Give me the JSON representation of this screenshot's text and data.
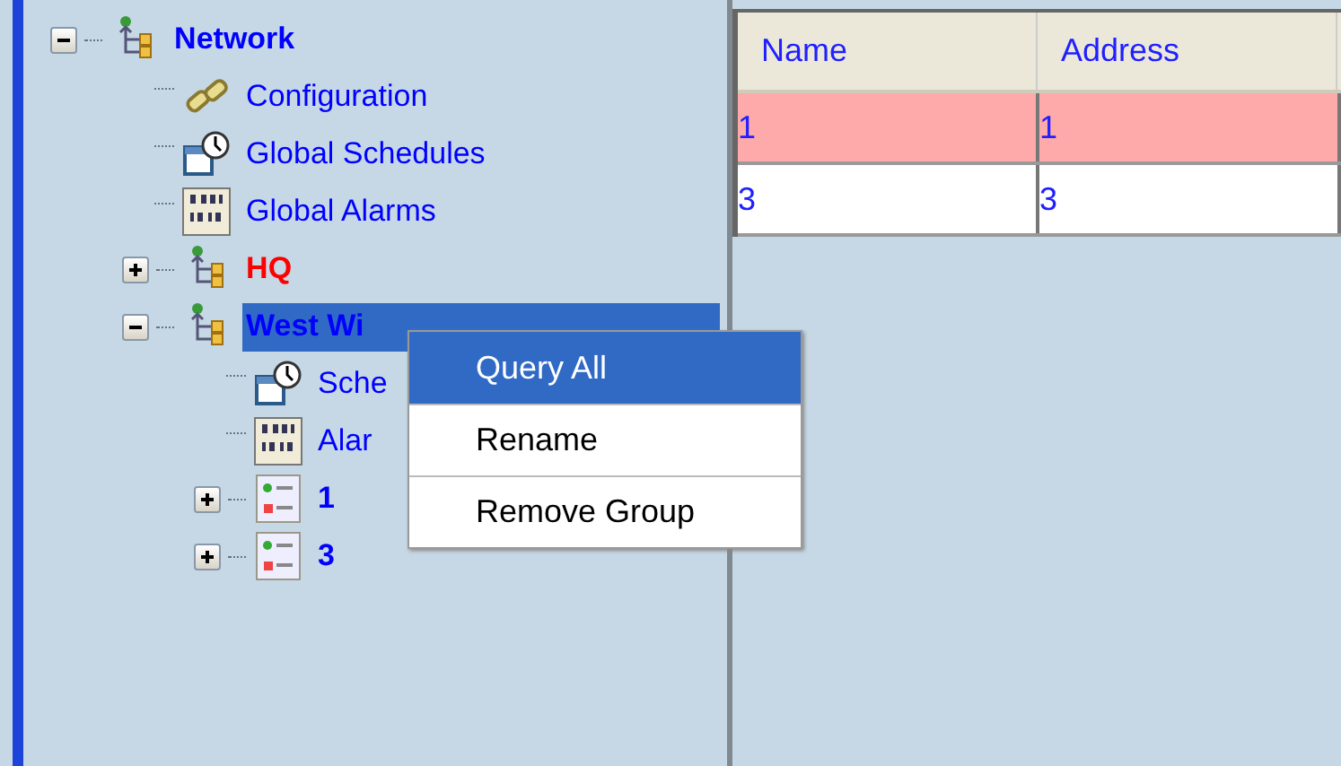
{
  "tree": [
    {
      "kind": "network",
      "label": "Network",
      "color": "#0000ff",
      "expanded": true,
      "selected": false,
      "children": [
        {
          "kind": "config",
          "label": "Configuration",
          "color": "#0000ff",
          "selected": false
        },
        {
          "kind": "schedule",
          "label": "Global Schedules",
          "color": "#0000ff",
          "selected": false
        },
        {
          "kind": "alarm",
          "label": "Global Alarms",
          "color": "#0000ff",
          "selected": false
        },
        {
          "kind": "group",
          "label": "HQ",
          "color": "#ff0000",
          "expanded": false,
          "selected": false
        },
        {
          "kind": "group",
          "label": "West Wi",
          "color": "#0000ff",
          "expanded": true,
          "selected": true,
          "children": [
            {
              "kind": "schedule",
              "label": "Sche",
              "color": "#0000ff",
              "selected": false
            },
            {
              "kind": "alarm",
              "label": "Alar",
              "color": "#0000ff",
              "selected": false
            },
            {
              "kind": "device",
              "label": "1",
              "color": "#0000ff",
              "expanded": false,
              "selected": false
            },
            {
              "kind": "device",
              "label": "3",
              "color": "#0000ff",
              "expanded": false,
              "selected": false
            }
          ]
        }
      ]
    }
  ],
  "context_menu": [
    {
      "label": "Query All",
      "selected": true
    },
    {
      "label": "Rename",
      "selected": false
    },
    {
      "label": "Remove Group",
      "selected": false
    }
  ],
  "table": {
    "columns": [
      "Name",
      "Address"
    ],
    "rows": [
      {
        "cells": [
          "1",
          "1"
        ],
        "highlighted": true
      },
      {
        "cells": [
          "3",
          "3"
        ],
        "highlighted": false
      }
    ]
  }
}
